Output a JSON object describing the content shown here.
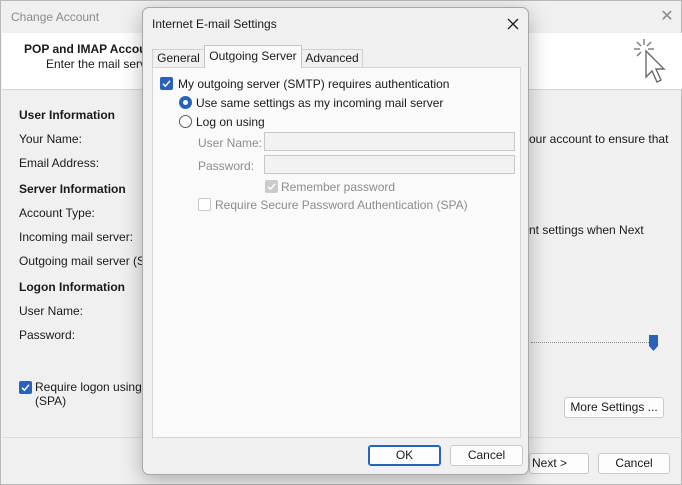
{
  "background_window": {
    "title": "Change Account",
    "header_title": "POP and IMAP Accour",
    "header_subtitle": "Enter the mail server",
    "sections": {
      "user_information": "User Information",
      "server_information": "Server Information",
      "logon_information": "Logon Information"
    },
    "labels": {
      "your_name": "Your Name:",
      "email_address": "Email Address:",
      "account_type": "Account Type:",
      "incoming_server": "Incoming mail server:",
      "outgoing_server": "Outgoing mail server (SM",
      "user_name": "User Name:",
      "password": "Password:"
    },
    "right_text_1": "our account to ensure that",
    "right_text_2": "nt settings when Next",
    "require_logon_label": "Require logon using",
    "require_logon_spa": "(SPA)",
    "more_settings_button": "More Settings ...",
    "next_button": "Next >",
    "cancel_button": "Cancel"
  },
  "dialog": {
    "title": "Internet E-mail Settings",
    "tabs": [
      "General",
      "Outgoing Server",
      "Advanced"
    ],
    "active_tab": "Outgoing Server",
    "smtp_auth_label": "My outgoing server (SMTP) requires authentication",
    "smtp_auth_checked": true,
    "use_same_settings_label": "Use same settings as my incoming mail server",
    "use_same_settings_selected": true,
    "log_on_using_label": "Log on using",
    "log_on_using_selected": false,
    "user_name_label": "User Name:",
    "user_name_value": "",
    "password_label": "Password:",
    "password_value": "",
    "remember_password_label": "Remember password",
    "remember_password_checked": true,
    "require_spa_label": "Require Secure Password Authentication (SPA)",
    "require_spa_checked": false,
    "ok_button": "OK",
    "cancel_button": "Cancel"
  },
  "colors": {
    "accent": "#2a62b8",
    "disabled_text": "#8c8c8c"
  }
}
